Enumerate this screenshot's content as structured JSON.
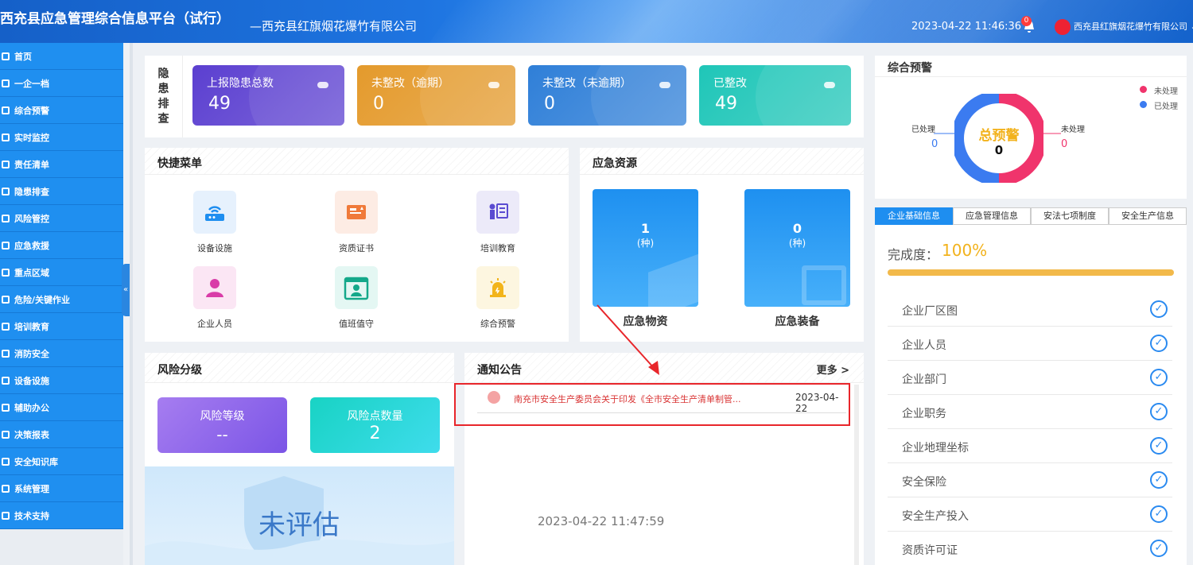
{
  "header": {
    "title": "西充县应急管理综合信息平台（试行）",
    "subtitle": "—西充县红旗烟花爆竹有限公司",
    "clock": "2023-04-22 11:46:36",
    "bell_badge": "0",
    "username": "西充县红旗烟花爆竹有限公司"
  },
  "sidebar": {
    "items": [
      "首页",
      "一企一档",
      "综合预警",
      "实时监控",
      "责任清单",
      "隐患排查",
      "风险管控",
      "应急救援",
      "重点区域",
      "危险/关键作业",
      "培训教育",
      "消防安全",
      "设备设施",
      "辅助办公",
      "决策报表",
      "安全知识库",
      "系统管理",
      "技术支持"
    ],
    "collapse": "«"
  },
  "hazard": {
    "side_label": [
      "隐",
      "患",
      "排",
      "查"
    ],
    "cards": [
      {
        "label": "上报隐患总数",
        "value": "49",
        "color": "#5b3fd0"
      },
      {
        "label": "未整改（逾期）",
        "value": "0",
        "color": "#e49a2c"
      },
      {
        "label": "未整改（未逾期）",
        "value": "0",
        "color": "#2f7fd8"
      },
      {
        "label": "已整改",
        "value": "49",
        "color": "#1fc6b8"
      }
    ]
  },
  "quick_menu": {
    "title": "快捷菜单",
    "items": [
      {
        "label": "设备设施",
        "icon": "router-icon"
      },
      {
        "label": "资质证书",
        "icon": "certificate-icon"
      },
      {
        "label": "培训教育",
        "icon": "teacher-icon"
      },
      {
        "label": "企业人员",
        "icon": "person-icon"
      },
      {
        "label": "值班值守",
        "icon": "calendar-duty-icon"
      },
      {
        "label": "综合预警",
        "icon": "alarm-light-icon"
      }
    ]
  },
  "resources": {
    "title": "应急资源",
    "items": [
      {
        "count": "1",
        "unit": "(种)",
        "label": "应急物资"
      },
      {
        "count": "0",
        "unit": "(种)",
        "label": "应急装备"
      }
    ]
  },
  "risk": {
    "title": "风险分级",
    "level_label": "风险等级",
    "level_value": "--",
    "points_label": "风险点数量",
    "points_value": "2",
    "status": "未评估"
  },
  "notice": {
    "title": "通知公告",
    "more": "更多 >",
    "items": [
      {
        "text": "南充市安全生产委员会关于印发《全市安全生产清单制管...",
        "date": "2023-04-22"
      }
    ],
    "overlay_time": "2023-04-22 11:47:59"
  },
  "warning": {
    "title": "综合预警",
    "center_label": "总预警",
    "center_value": "0",
    "legend": [
      {
        "label": "未处理",
        "color": "#f0346c"
      },
      {
        "label": "已处理",
        "color": "#3b7bf0"
      }
    ],
    "left_label": "已处理",
    "left_value": "0",
    "right_label": "未处理",
    "right_value": "0",
    "chart_data": {
      "type": "pie",
      "categories": [
        "未处理",
        "已处理"
      ],
      "values": [
        0,
        0
      ]
    }
  },
  "tabs": [
    "企业基础信息",
    "应急管理信息",
    "安法七项制度",
    "安全生产信息"
  ],
  "completion": {
    "label": "完成度：",
    "value": "100%",
    "percent": 100
  },
  "checklist": [
    "企业厂区图",
    "企业人员",
    "企业部门",
    "企业职务",
    "企业地理坐标",
    "安全保险",
    "安全生产投入",
    "资质许可证"
  ]
}
